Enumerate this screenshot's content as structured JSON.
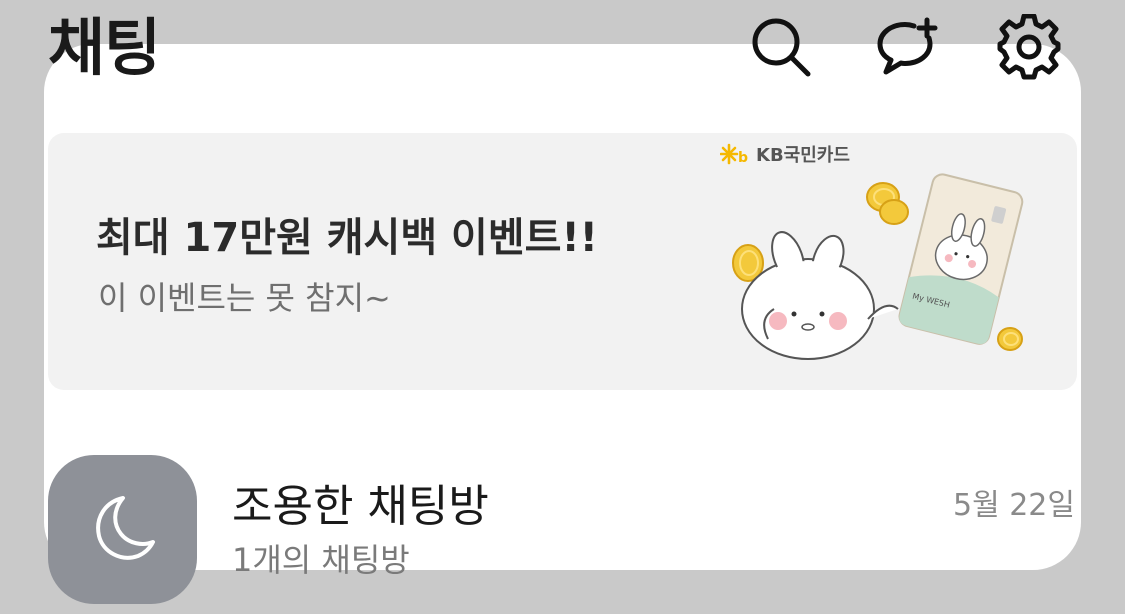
{
  "header": {
    "title": "채팅",
    "icons": [
      "search-icon",
      "new-chat-icon",
      "settings-icon"
    ]
  },
  "banner": {
    "title": "최대 17만원 캐시백 이벤트!!",
    "subtitle": "이 이벤트는 못 참지~",
    "brand": "KB국민카드",
    "card_text": "My WESH"
  },
  "chat_list": [
    {
      "name": "조용한 채팅방",
      "preview": "1개의 채팅방",
      "date": "5월 22일",
      "icon": "moon-icon"
    }
  ],
  "colors": {
    "background": "#c9c9c9",
    "panel": "#ffffff",
    "banner": "#f2f2f2",
    "avatar": "#8e9198",
    "brand_accent": "#f5b800"
  }
}
